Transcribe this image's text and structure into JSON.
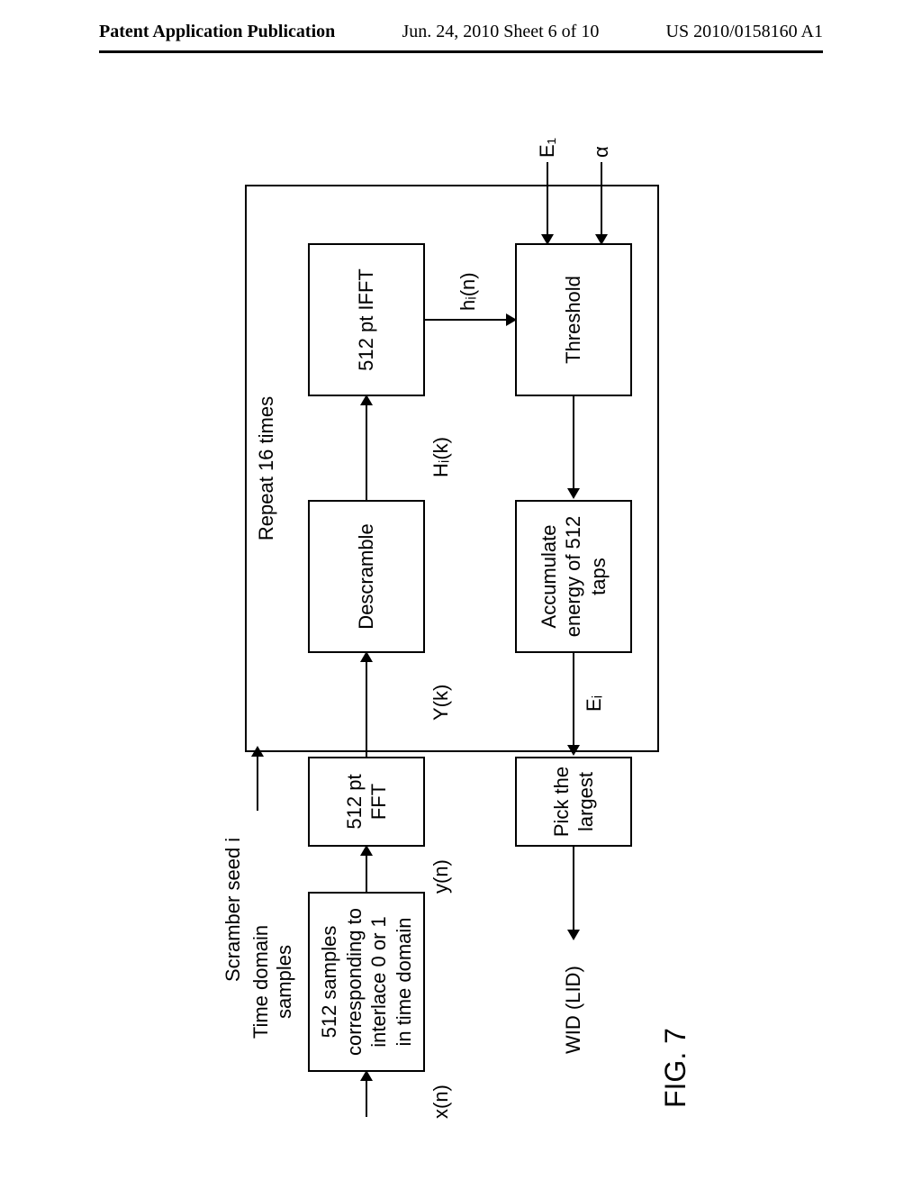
{
  "header": {
    "left": "Patent Application Publication",
    "center": "Jun. 24, 2010  Sheet 6 of 10",
    "right": "US 2010/0158160 A1"
  },
  "figure_label": "FIG. 7",
  "top_labels": {
    "time_domain": "Time domain\nsamples",
    "scrambler_seed": "Scramber seed i",
    "repeat": "Repeat 16 times"
  },
  "boxes": {
    "b512_samples": "512 samples\ncorresponding to\ninterlace 0 or 1\nin time domain",
    "fft": "512 pt FFT",
    "descramble": "Descramble",
    "ifft": "512 pt IFFT",
    "pick": "Pick the\nlargest",
    "accum": "Accumulate\nenergy of 512\ntaps",
    "threshold": "Threshold"
  },
  "signal_labels": {
    "xin": "x(n)",
    "yn": "y(n)",
    "Yk": "Y(k)",
    "Hik": "Hᵢ(k)",
    "hin": "hᵢ(n)",
    "Ei": "Eᵢ",
    "E1": "E₁",
    "alpha": "α",
    "wid": "WID (LID)"
  }
}
